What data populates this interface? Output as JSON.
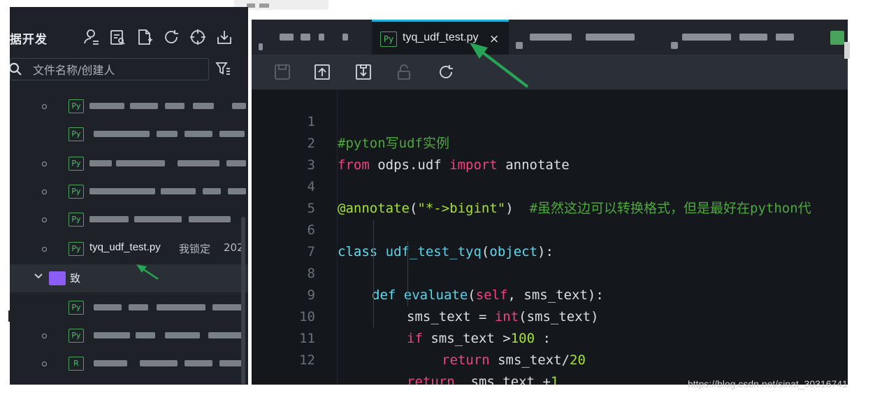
{
  "app": {
    "panel_title": "据开发",
    "search": {
      "placeholder": "文件名称/创建人",
      "value": ""
    }
  },
  "toolbar_icons": [
    "new-user-icon",
    "query-file-icon",
    "new-file-icon",
    "refresh-icon",
    "locate-icon",
    "import-icon"
  ],
  "file_tree": {
    "selected": {
      "icon_label": "Py",
      "name": "tyq_udf_test.py",
      "lock_status": "我锁定",
      "date": "202"
    },
    "folder": {
      "expanded": true,
      "name_suffix": "致"
    },
    "row_icon_labels": [
      "Py",
      "Py",
      "Py",
      "Py",
      "Py",
      "Py",
      "Py",
      "Py",
      "R"
    ]
  },
  "editor": {
    "active_tab": {
      "icon_label": "Py",
      "name": "tyq_udf_test.py",
      "close": "×"
    },
    "toolbar_buttons": [
      "save-icon",
      "upload-icon",
      "submit-icon",
      "lock-icon",
      "reload-icon"
    ],
    "line_numbers": [
      "1",
      "2",
      "3",
      "4",
      "5",
      "6",
      "7",
      "8",
      "9",
      "10",
      "11",
      "12"
    ],
    "code": {
      "l1": {
        "comment": "#pyton写udf实例"
      },
      "l2": {
        "kw1": "from",
        "mod": " odps.udf ",
        "kw2": "import",
        "name": " annotate"
      },
      "l4": {
        "deco": "@annotate",
        "paren_open": "(",
        "str": "\"*->bigint\"",
        "paren_close": ")",
        "comment": "  #虽然这边可以转换格式，但是最好在python代"
      },
      "l6": {
        "kw": "class",
        "name": " udf_test_tyq",
        "p1": "(",
        "base": "object",
        "p2": "):"
      },
      "l7": {
        "kw": "def",
        "name": " evaluate",
        "p1": "(",
        "self": "self",
        "rest": ", sms_text):"
      },
      "l8": {
        "lhs": "sms_text = ",
        "fn": "int",
        "rest": "(sms_text)"
      },
      "l9": {
        "kw": "if",
        "mid": " sms_text >",
        "num": "100",
        "rest": " :"
      },
      "l10": {
        "kw": "return",
        "mid": " sms_text/",
        "num": "20"
      },
      "l11": {
        "kw": "return",
        "mid": "  sms_text +",
        "num": "1"
      }
    }
  },
  "watermark": "https://blog.csdn.net/sinat_30316741",
  "colors": {
    "accent_tab": "#1fb1d6",
    "arrow": "#27a556",
    "keyword": "#f0447e",
    "function": "#5bd3e8",
    "comment": "#4fa83d",
    "number": "#b99cf8",
    "string": "#a6e22e"
  }
}
